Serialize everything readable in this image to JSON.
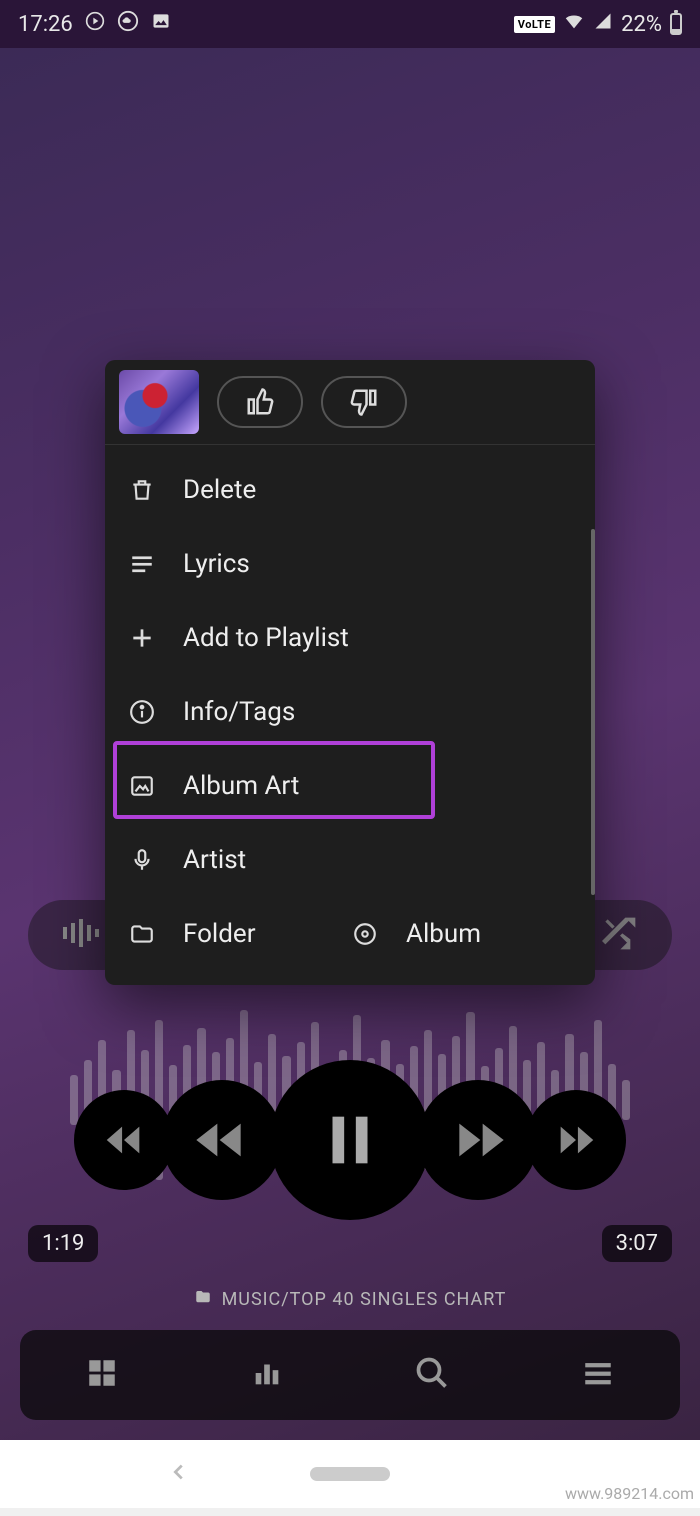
{
  "status": {
    "time": "17:26",
    "volte": "VoLTE",
    "battery_pct": "22%"
  },
  "player": {
    "elapsed": "1:19",
    "total": "3:07",
    "path": "MUSIC/TOP 40 SINGLES CHART"
  },
  "menu": {
    "delete": "Delete",
    "lyrics": "Lyrics",
    "addToPlaylist": "Add to Playlist",
    "infoTags": "Info/Tags",
    "albumArt": "Album Art",
    "artist": "Artist",
    "folder": "Folder",
    "album": "Album"
  },
  "highlight_color": "#b040d8",
  "watermark": "www.989214.com"
}
